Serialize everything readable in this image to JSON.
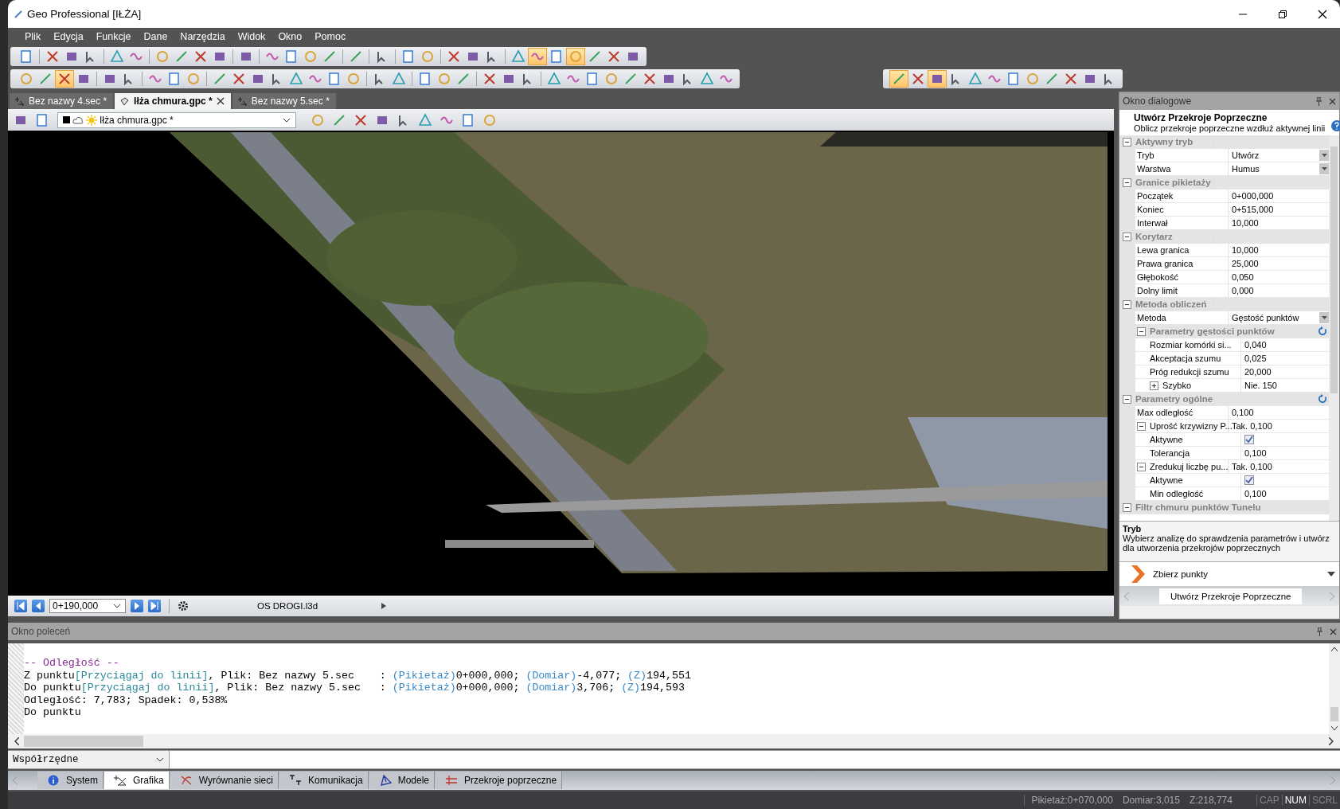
{
  "window": {
    "title": "Geo Professional [IŁŻA]"
  },
  "menu": [
    "Plik",
    "Edycja",
    "Funkcje",
    "Dane",
    "Narzędzia",
    "Widok",
    "Okno",
    "Pomoc"
  ],
  "toolbars": [
    {
      "groups": [
        [
          {
            "on": false
          }
        ],
        [
          {
            "on": false
          },
          {
            "on": false
          },
          {
            "on": false
          }
        ],
        [
          {
            "on": false
          },
          {
            "on": false
          }
        ],
        [
          {
            "on": false
          },
          {
            "on": false
          },
          {
            "on": false
          },
          {
            "on": false
          }
        ],
        [
          {
            "on": false
          }
        ],
        [
          {
            "on": false
          },
          {
            "on": false
          },
          {
            "on": false
          },
          {
            "on": false
          }
        ],
        [
          {
            "on": false
          }
        ],
        [
          {
            "on": false
          }
        ],
        [
          {
            "on": false
          },
          {
            "on": false
          }
        ],
        [
          {
            "on": false
          },
          {
            "on": false
          },
          {
            "on": false
          }
        ],
        [
          {
            "on": false
          },
          {
            "on": true
          },
          {
            "on": false
          },
          {
            "on": true
          },
          {
            "on": false
          },
          {
            "on": false
          },
          {
            "on": false
          }
        ]
      ]
    },
    {
      "groups": [
        [
          {
            "on": false
          },
          {
            "on": false
          },
          {
            "on": true
          },
          {
            "on": false
          }
        ],
        [
          {
            "on": false
          },
          {
            "on": false
          }
        ],
        [
          {
            "on": false
          },
          {
            "on": false
          },
          {
            "on": false
          }
        ],
        [
          {
            "on": false
          },
          {
            "on": false
          },
          {
            "on": false
          },
          {
            "on": false
          },
          {
            "on": false
          },
          {
            "on": false
          },
          {
            "on": false
          },
          {
            "on": false
          }
        ],
        [
          {
            "on": false
          },
          {
            "on": false
          }
        ],
        [
          {
            "on": false
          },
          {
            "on": false
          },
          {
            "on": false
          }
        ],
        [
          {
            "on": false
          },
          {
            "on": false
          },
          {
            "on": false
          }
        ],
        [
          {
            "on": false
          },
          {
            "on": false
          },
          {
            "on": false
          },
          {
            "on": false
          },
          {
            "on": false
          },
          {
            "on": false
          },
          {
            "on": false
          },
          {
            "on": false
          },
          {
            "on": false
          },
          {
            "on": false
          }
        ]
      ]
    }
  ],
  "snap_toolbar": {
    "buttons": [
      {
        "on": true
      },
      {
        "on": false
      },
      {
        "on": true
      },
      {
        "on": false
      },
      {
        "on": false
      },
      {
        "on": false
      },
      {
        "on": false
      },
      {
        "on": false
      },
      {
        "on": false
      },
      {
        "on": false
      },
      {
        "on": false
      },
      {
        "on": false
      }
    ]
  },
  "document_tabs": [
    {
      "label": "Bez nazwy 4.sec *",
      "selected": false,
      "kind": "section"
    },
    {
      "label": "Iłża chmura.gpc *",
      "selected": true,
      "kind": "cloud"
    },
    {
      "label": "Bez nazwy 5.sec *",
      "selected": false,
      "kind": "section"
    }
  ],
  "view_toolbar": {
    "layer": "Iłża chmura.gpc *"
  },
  "navigator": {
    "station": "0+190,000",
    "alignment": "OS DROGI.l3d"
  },
  "dialog": {
    "title": "Okno dialogowe",
    "command": {
      "title": "Utwórz Przekroje Poprzeczne",
      "subtitle": "Oblicz przekroje poprzeczne wzdłuż aktywnej linii"
    },
    "sections": [
      {
        "label": "Aktywny tryb",
        "expanded": true,
        "rows": [
          {
            "kind": "dropdown",
            "label": "Tryb",
            "value": "Utwórz"
          },
          {
            "kind": "dropdown",
            "label": "Warstwa",
            "value": "Humus"
          }
        ]
      },
      {
        "label": "Granice pikietaży",
        "expanded": true,
        "rows": [
          {
            "kind": "text",
            "label": "Początek",
            "value": "0+000,000"
          },
          {
            "kind": "text",
            "label": "Koniec",
            "value": "0+515,000"
          },
          {
            "kind": "text",
            "label": "Interwał",
            "value": "10,000"
          }
        ]
      },
      {
        "label": "Korytarz",
        "expanded": true,
        "rows": [
          {
            "kind": "text",
            "label": "Lewa granica",
            "value": "10,000"
          },
          {
            "kind": "text",
            "label": "Prawa granica",
            "value": "25,000"
          },
          {
            "kind": "text",
            "label": "Głębokość",
            "value": "0,050"
          },
          {
            "kind": "text",
            "label": "Dolny limit",
            "value": "0,000"
          }
        ]
      },
      {
        "label": "Metoda obliczeń",
        "expanded": true,
        "rows": [
          {
            "kind": "dropdown",
            "label": "Metoda",
            "value": "Gęstość punktów"
          },
          {
            "kind": "category",
            "label": "Parametry gęstości punktów",
            "expanded": true,
            "reset": true,
            "children": [
              {
                "kind": "text",
                "label": "Rozmiar komórki si...",
                "value": "0,040"
              },
              {
                "kind": "text",
                "label": "Akceptacja szumu",
                "value": "0,025"
              },
              {
                "kind": "text",
                "label": "Próg redukcji szumu",
                "value": "20,000"
              },
              {
                "kind": "group",
                "label": "Szybko",
                "value": "Nie. 150",
                "expanded": false
              }
            ]
          }
        ]
      },
      {
        "label": "Parametry ogólne",
        "expanded": true,
        "reset": true,
        "rows": [
          {
            "kind": "text",
            "label": "Max odległość",
            "value": "0,100"
          },
          {
            "kind": "group",
            "label": "Uprość krzywizny P...",
            "value": "Tak. 0,100",
            "expanded": true,
            "children": [
              {
                "kind": "checkbox",
                "label": "Aktywne",
                "checked": true
              },
              {
                "kind": "text",
                "label": "Tolerancja",
                "value": "0,100"
              }
            ]
          },
          {
            "kind": "group",
            "label": "Zredukuj liczbę pu...",
            "value": "Tak. 0,100",
            "expanded": true,
            "children": [
              {
                "kind": "checkbox",
                "label": "Aktywne",
                "checked": true
              },
              {
                "kind": "text",
                "label": "Min odległość",
                "value": "0,100"
              }
            ]
          }
        ]
      },
      {
        "label": "Filtr chmuru punktów Tunelu",
        "expanded": true
      }
    ],
    "help": {
      "title": "Tryb",
      "text": "Wybierz analizę do sprawdzenia parametrów i utwórz dla utworzenia przekrojów poprzecznych"
    },
    "action": "Zbierz punkty",
    "tab": "Utwórz Przekroje Poprzeczne"
  },
  "console": {
    "title": "Okno poleceń",
    "lines": [
      {
        "segments": [
          {
            "kind": "heading",
            "text": "-- Odległość --"
          }
        ]
      },
      {
        "segments": [
          {
            "kind": "plain",
            "text": "Z punktu"
          },
          {
            "kind": "option",
            "text": "[Przyciągaj do linii]"
          },
          {
            "kind": "plain",
            "text": ", Plik: Bez nazwy 5.sec    : "
          },
          {
            "kind": "field",
            "text": "(Pikietaż)"
          },
          {
            "kind": "plain",
            "text": "0+000,000; "
          },
          {
            "kind": "field",
            "text": "(Domiar)"
          },
          {
            "kind": "plain",
            "text": "-4,077; "
          },
          {
            "kind": "field",
            "text": "(Z)"
          },
          {
            "kind": "plain",
            "text": "194,551"
          }
        ]
      },
      {
        "segments": [
          {
            "kind": "plain",
            "text": "Do punktu"
          },
          {
            "kind": "option",
            "text": "[Przyciągaj do linii]"
          },
          {
            "kind": "plain",
            "text": ", Plik: Bez nazwy 5.sec   : "
          },
          {
            "kind": "field",
            "text": "(Pikietaż)"
          },
          {
            "kind": "plain",
            "text": "0+000,000; "
          },
          {
            "kind": "field",
            "text": "(Domiar)"
          },
          {
            "kind": "plain",
            "text": "3,706; "
          },
          {
            "kind": "field",
            "text": "(Z)"
          },
          {
            "kind": "plain",
            "text": "194,593"
          }
        ]
      },
      {
        "segments": [
          {
            "kind": "plain",
            "text": "Odległość: 7,783; Spadek: 0,538%"
          }
        ]
      },
      {
        "segments": [
          {
            "kind": "plain",
            "text": "Do punktu"
          }
        ]
      }
    ],
    "input_mode": "Współrzędne"
  },
  "bottom_tabs": [
    {
      "label": "System",
      "selected": false,
      "kind": "info"
    },
    {
      "label": "Grafika",
      "selected": true,
      "kind": "graphics"
    },
    {
      "label": "Wyrównanie sieci",
      "selected": false,
      "kind": "network"
    },
    {
      "label": "Komunikacja",
      "selected": false,
      "kind": "communication"
    },
    {
      "label": "Modele",
      "selected": false,
      "kind": "models"
    },
    {
      "label": "Przekroje poprzeczne",
      "selected": false,
      "kind": "sections"
    }
  ],
  "status_bar": {
    "coordinates": [
      "Pikietaż:0+070,000",
      "Domiar:3,015",
      "Z:218,774"
    ],
    "indicators": [
      {
        "label": "CAP",
        "on": false
      },
      {
        "label": "NUM",
        "on": true
      },
      {
        "label": "SCRL",
        "on": false
      }
    ]
  }
}
